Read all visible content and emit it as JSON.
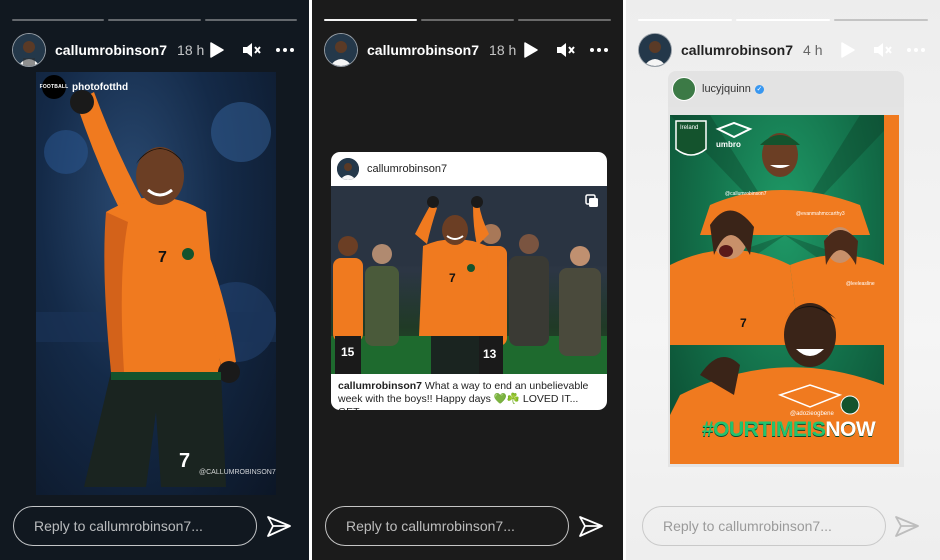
{
  "stories": [
    {
      "username": "callumrobinson7",
      "time": "18 h",
      "reply_placeholder": "Reply to callumrobinson7...",
      "reshare_credit": "photofotthd",
      "credit_logo_text": "FOOTBALL",
      "watermark": "@CALLUMROBINSON7",
      "jersey_number": "7"
    },
    {
      "username": "callumrobinson7",
      "time": "18 h",
      "reply_placeholder": "Reply to callumrobinson7...",
      "post": {
        "username": "callumrobinson7",
        "caption_user": "callumrobinson7",
        "caption_text": " What a way to end an unbelievable week with the boys!! Happy days 💚☘️ LOVED IT... GET...",
        "numbers": [
          "7",
          "15",
          "13"
        ]
      }
    },
    {
      "username": "callumrobinson7",
      "time": "4 h",
      "reply_placeholder": "Reply to callumrobinson7...",
      "reshare_from": "lucyjquinn",
      "hashtag_green": "#OURTIMEIS",
      "hashtag_white": "NOW",
      "poster_texts": [
        "Ireland",
        "umbro",
        "@callumrobinson7",
        "@evanmahmccarthy3",
        "@leeleasline",
        "@adozieogbene",
        "7"
      ]
    }
  ],
  "colors": {
    "orange": "#f07a1f",
    "green": "#1f9a67",
    "verified": "#3897f0"
  }
}
